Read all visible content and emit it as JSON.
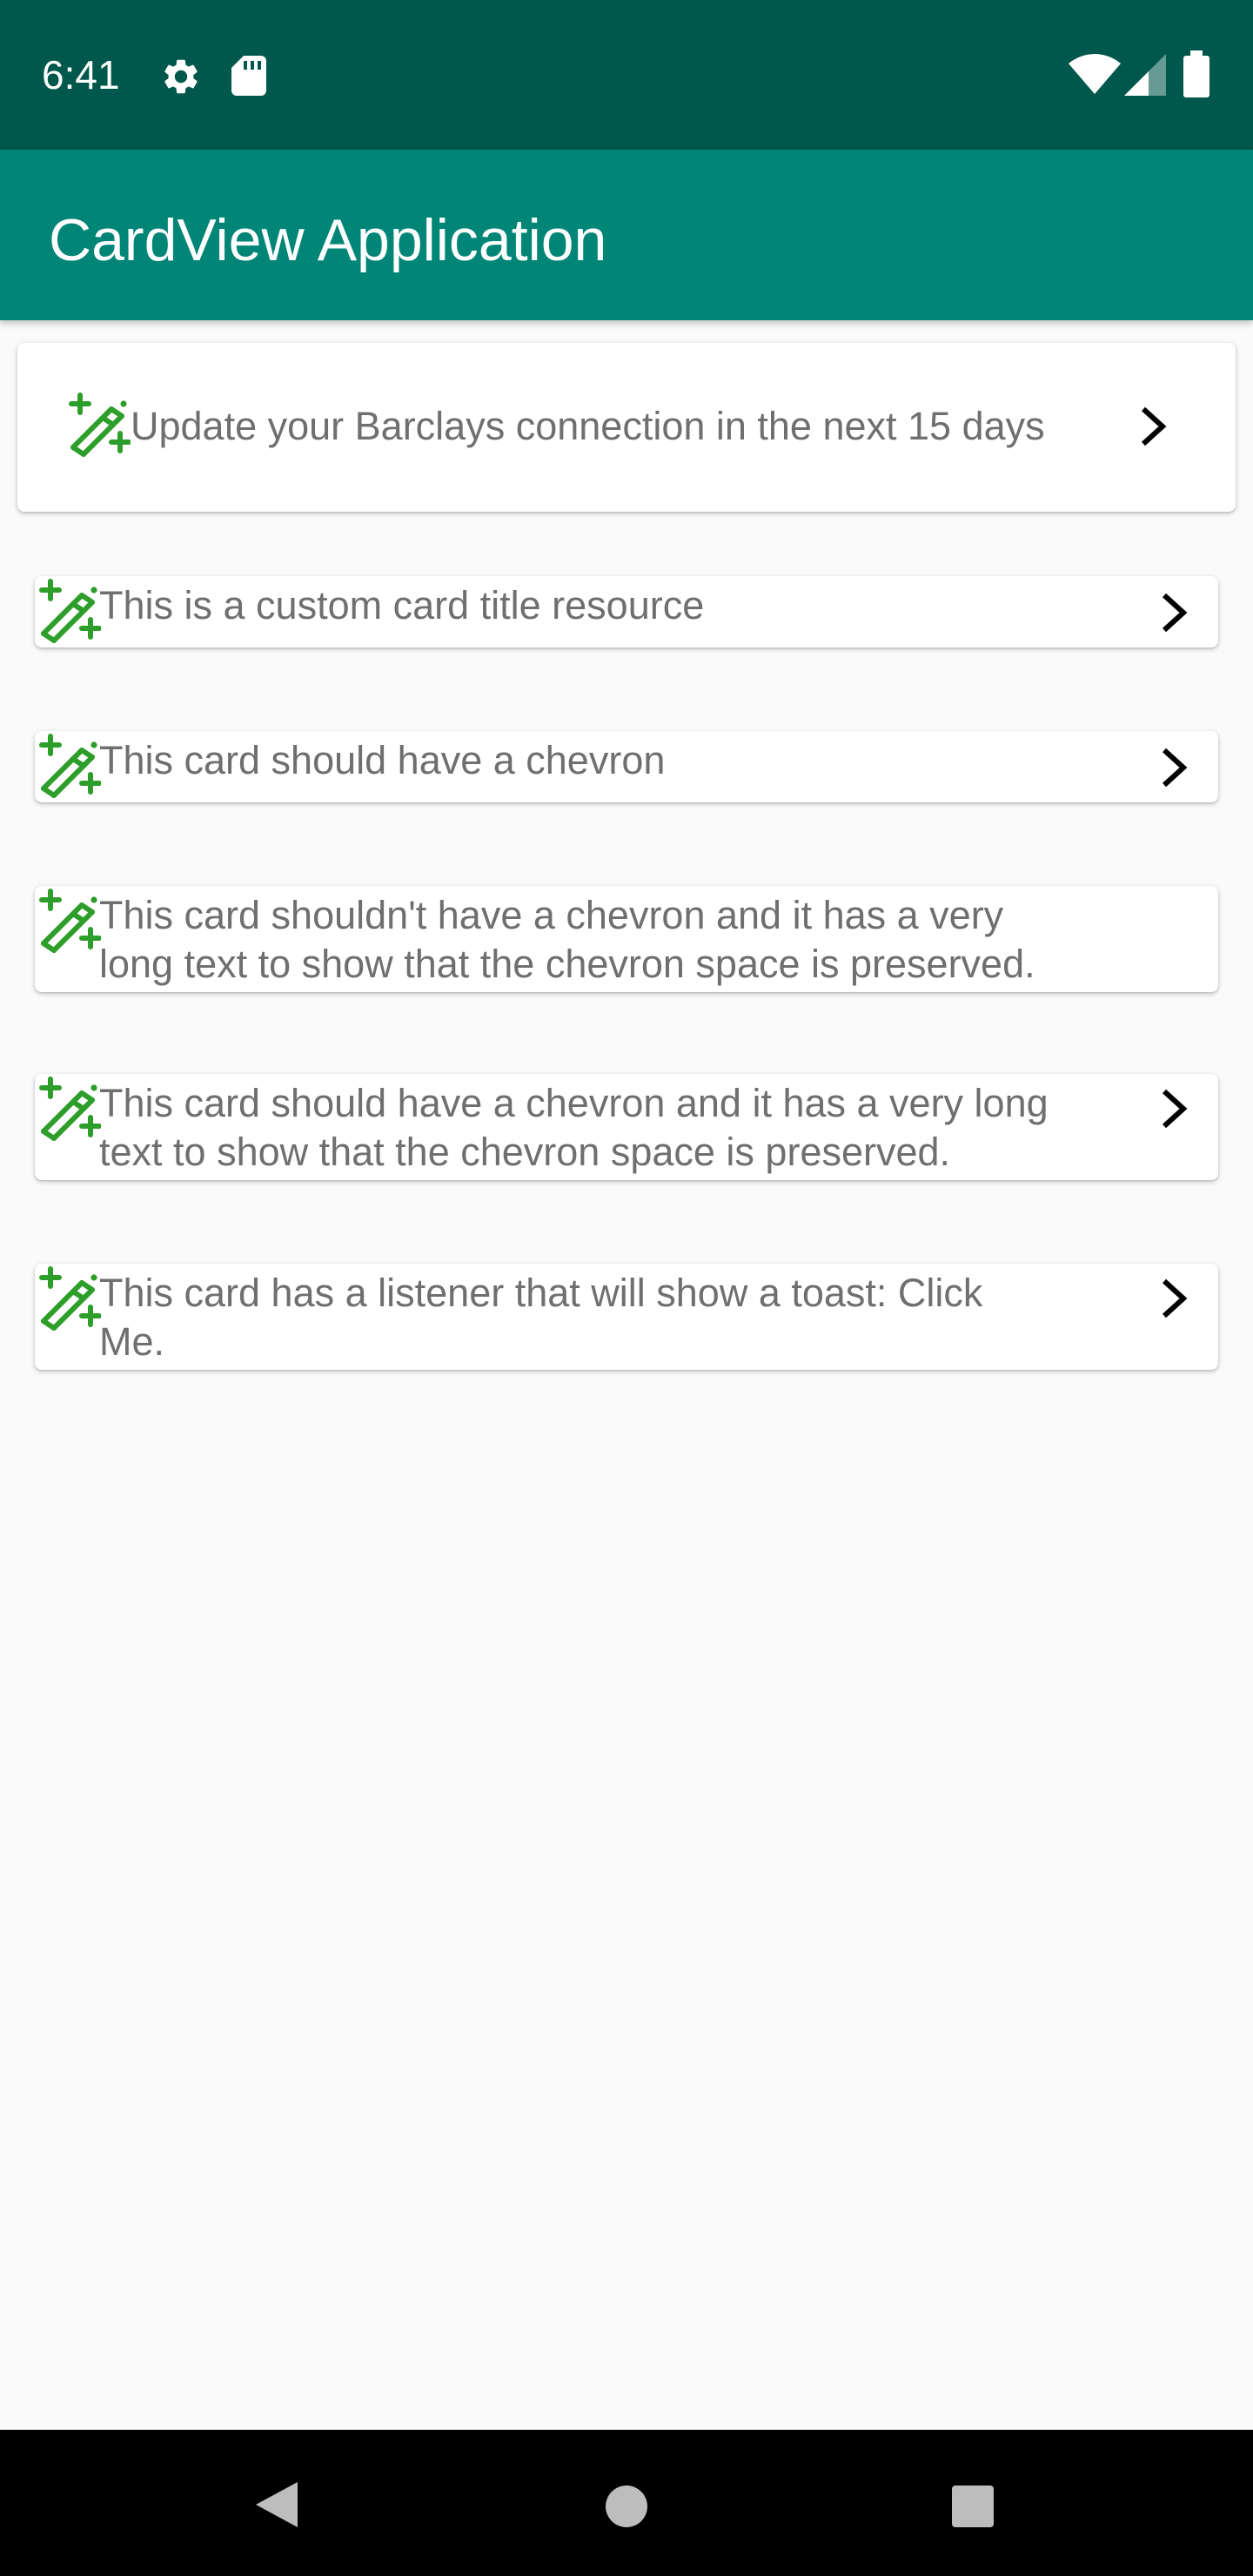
{
  "status_bar": {
    "time": "6:41",
    "icons": [
      "settings-icon",
      "sd-card-icon",
      "wifi-icon",
      "cellular-signal-icon",
      "battery-icon"
    ]
  },
  "app_bar": {
    "title": "CardView Application"
  },
  "cards": [
    {
      "text": "Update your Barclays connection in the next 15 days",
      "icon": "magic-wand-icon",
      "chevron": true
    },
    {
      "text": "This is a custom card title resource",
      "icon": "magic-wand-icon",
      "chevron": true
    },
    {
      "text": "This card should have a chevron",
      "icon": "magic-wand-icon",
      "chevron": true
    },
    {
      "text": "This card shouldn't have a chevron and it has a very\nlong text to show that the chevron space is preserved.",
      "icon": "magic-wand-icon",
      "chevron": false
    },
    {
      "text": "This card should have a chevron and it has a very long\ntext to show that the chevron space is preserved.",
      "icon": "magic-wand-icon",
      "chevron": true
    },
    {
      "text": "This card has a listener that will show a toast: Click\nMe.",
      "icon": "magic-wand-icon",
      "chevron": true
    }
  ],
  "nav_bar": {
    "buttons": [
      "back-icon",
      "home-icon",
      "recents-icon"
    ]
  },
  "colors": {
    "status_bar": "#00574b",
    "app_bar": "#008577",
    "icon_green": "#2e9e2a",
    "card_text": "#6f6f6f",
    "background": "#fafafa"
  }
}
